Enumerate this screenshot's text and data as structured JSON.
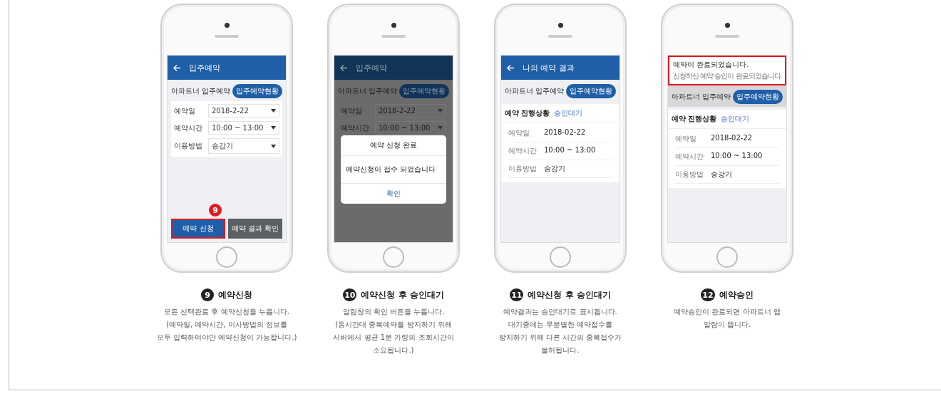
{
  "phones": [
    {
      "kind": "form",
      "header": {
        "title": "입주예약"
      },
      "section": "아파트너 입주예약",
      "pill": "입주예약현황",
      "fields": [
        {
          "label": "예약일",
          "value": "2018-2-22"
        },
        {
          "label": "예약시간",
          "value": "10:00 ~ 13:00"
        },
        {
          "label": "이용방법",
          "value": "승강기"
        }
      ],
      "marker": "9",
      "buttons": [
        {
          "label": "예약 신청",
          "highlighted": true
        },
        {
          "label": "예약 결과 확인",
          "highlighted": false
        }
      ]
    },
    {
      "kind": "dialog",
      "header": {
        "title": "입주예약"
      },
      "section": "아파트너 입주예약",
      "pill": "입주예약현황",
      "fields": [
        {
          "label": "예약일",
          "value": "2018-2-22"
        },
        {
          "label": "예약시간",
          "value": "10:00 ~ 13:00"
        }
      ],
      "dialog": {
        "title": "예약 신청 완료",
        "message": "예약신청이 접수 되었습니다",
        "button": "확인"
      }
    },
    {
      "kind": "result",
      "header": {
        "title": "나의 예약 결과"
      },
      "section": "아파트너 입주예약",
      "pill": "입주예약현황",
      "status_label": "예약 진행상황",
      "status": "승인대기",
      "details": [
        {
          "label": "예약일",
          "value": "2018-02-22"
        },
        {
          "label": "예약시간",
          "value": "10:00 ~ 13:00"
        },
        {
          "label": "이용방법",
          "value": "승강기"
        }
      ]
    },
    {
      "kind": "notified",
      "notification": {
        "title": "예약이 완료되었습니다.",
        "message": "신청하신 예약 승인이 완료되었습니다.",
        "highlighted": true
      },
      "section": "아파트너 입주예약",
      "pill": "입주예약현황",
      "status_label": "예약 진행상황",
      "status": "승인대기",
      "details": [
        {
          "label": "예약일",
          "value": "2018-02-22"
        },
        {
          "label": "예약시간",
          "value": "10:00 ~ 13:00"
        },
        {
          "label": "이용방법",
          "value": "승강기"
        }
      ]
    }
  ],
  "captions": [
    {
      "number": "9",
      "title": "예약신청",
      "body": "모든 선택완료 후 예약신청을 누릅니다.\n(예약일, 예약시간, 이사방법의 정보를\n모두 입력하여야만 예약신청이 가능합니다.)"
    },
    {
      "number": "10",
      "title": "예약신청 후 승인대기",
      "body": "알림창의 확인 버튼을 누릅니다.\n(동시간대 중복예약을 방지하기 위해\n서버에서 평균 1분 가량의 조회시간이\n소요됩니다.)"
    },
    {
      "number": "11",
      "title": "예약신청 후 승인대기",
      "body": "예약결과는 승인대기로 표시됩니다.\n대기중에는 무분별한 예약접수를\n방지하기 위해 다른 시간의 중복접수가\n불허됩니다."
    },
    {
      "number": "12",
      "title": "예약승인",
      "body": "예약승인이 완료되면 아파트너 앱\n알람이 뜹니다."
    }
  ]
}
